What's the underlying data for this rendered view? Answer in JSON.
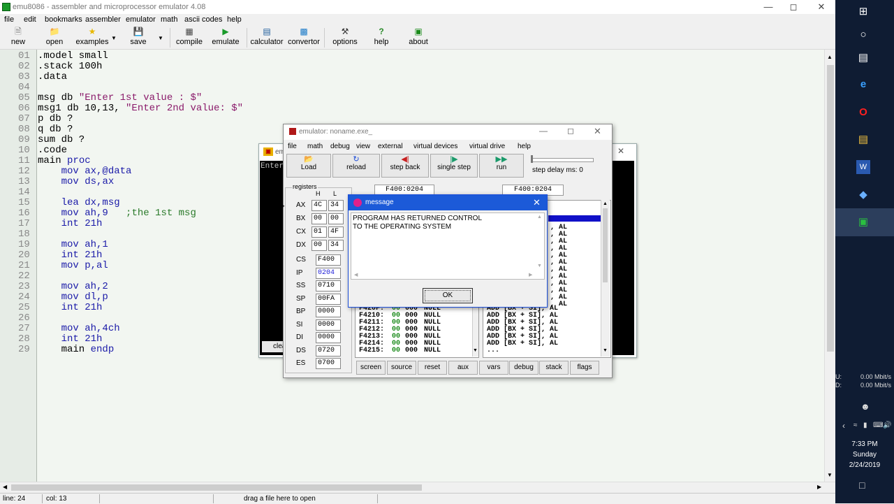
{
  "app": {
    "title": "emu8086 - assembler and microprocessor emulator 4.08"
  },
  "menu": [
    "file",
    "edit",
    "bookmarks",
    "assembler",
    "emulator",
    "math",
    "ascii codes",
    "help"
  ],
  "toolbar": [
    "new",
    "open",
    "examples",
    "save",
    "compile",
    "emulate",
    "calculator",
    "convertor",
    "options",
    "help",
    "about"
  ],
  "editor": {
    "line_numbers": [
      "01",
      "02",
      "03",
      "04",
      "05",
      "06",
      "07",
      "08",
      "09",
      "10",
      "11",
      "12",
      "13",
      "14",
      "15",
      "16",
      "17",
      "18",
      "19",
      "20",
      "21",
      "22",
      "23",
      "24",
      "25",
      "26",
      "27",
      "28",
      "29"
    ],
    "lines": [
      ".model small",
      ".stack 100h",
      ".data",
      "",
      "msg db \"Enter 1st value : $\"",
      "msg1 db 10,13, \"Enter 2nd value: $\"",
      "p db ?",
      "q db ?",
      "sum db ?",
      ".code",
      "main proc",
      "    mov ax,@data",
      "    mov ds,ax",
      "",
      "    lea dx,msg",
      "    mov ah,9   ;the 1st msg",
      "    int 21h",
      "",
      "    mov ah,1",
      "    int 21h",
      "    mov p,al",
      "",
      "    mov ah,2",
      "    mov dl,p",
      "    int 21h",
      "",
      "    mov ah,4ch",
      "    int 21h",
      "    main endp"
    ]
  },
  "status": {
    "line": "line: 24",
    "col": "col: 13",
    "hint": "drag a file here to open"
  },
  "output_window": {
    "title_partial": "em",
    "screen_text": "Enter",
    "clear_partial": "clea"
  },
  "emulator": {
    "title": "emulator: noname.exe_",
    "menu": [
      "file",
      "math",
      "debug",
      "view",
      "external",
      "virtual devices",
      "virtual drive",
      "help"
    ],
    "buttons": [
      "Load",
      "reload",
      "step back",
      "single step",
      "run"
    ],
    "step_delay": "step delay ms: 0",
    "registers_label": "registers",
    "hl": [
      "H",
      "L"
    ],
    "regs_hl": [
      {
        "name": "AX",
        "h": "4C",
        "l": "34"
      },
      {
        "name": "BX",
        "h": "00",
        "l": "00"
      },
      {
        "name": "CX",
        "h": "01",
        "l": "4F"
      },
      {
        "name": "DX",
        "h": "00",
        "l": "34"
      }
    ],
    "regs": [
      {
        "name": "CS",
        "v": "F400"
      },
      {
        "name": "IP",
        "v": "0204"
      },
      {
        "name": "SS",
        "v": "0710"
      },
      {
        "name": "SP",
        "v": "00FA"
      },
      {
        "name": "BP",
        "v": "0000"
      },
      {
        "name": "SI",
        "v": "0000"
      },
      {
        "name": "DI",
        "v": "0000"
      },
      {
        "name": "DS",
        "v": "0720"
      },
      {
        "name": "ES",
        "v": "0700"
      }
    ],
    "addr_left": "F400:0204",
    "addr_right": "F400:0204",
    "mem_rows": [
      {
        "a": "F420F:",
        "b": "00",
        "c": "000",
        "d": "NULL"
      },
      {
        "a": "F4210:",
        "b": "00",
        "c": "000",
        "d": "NULL"
      },
      {
        "a": "F4211:",
        "b": "00",
        "c": "000",
        "d": "NULL"
      },
      {
        "a": "F4212:",
        "b": "00",
        "c": "000",
        "d": "NULL"
      },
      {
        "a": "F4213:",
        "b": "00",
        "c": "000",
        "d": "NULL"
      },
      {
        "a": "F4214:",
        "b": "00",
        "c": "000",
        "d": "NULL"
      },
      {
        "a": "F4215:",
        "b": "00",
        "c": "000",
        "d": "NULL"
      }
    ],
    "dis_right": [
      ", AL",
      ", AL",
      ", AL",
      ", AL",
      ", AL",
      ", AL",
      ", AL",
      ", AL",
      ", AL",
      ", AL",
      ", AL",
      ", AL"
    ],
    "dis_rows": [
      "ADD [BX + SI], AL",
      "ADD [BX + SI], AL",
      "ADD [BX + SI], AL",
      "ADD [BX + SI], AL",
      "ADD [BX + SI], AL",
      "ADD [BX + SI], AL",
      "..."
    ],
    "bottom_buttons": [
      "screen",
      "source",
      "reset",
      "aux",
      "vars",
      "debug",
      "stack",
      "flags"
    ]
  },
  "message": {
    "title": "message",
    "line1": "PROGRAM HAS RETURNED CONTROL",
    "line2": "TO THE OPERATING SYSTEM",
    "ok": "OK"
  },
  "tray": {
    "up": "U:",
    "down": "D:",
    "up_rate": "0.00 Mbit/s",
    "down_rate": "0.00 Mbit/s",
    "time": "7:33 PM",
    "day": "Sunday",
    "date": "2/24/2019"
  }
}
